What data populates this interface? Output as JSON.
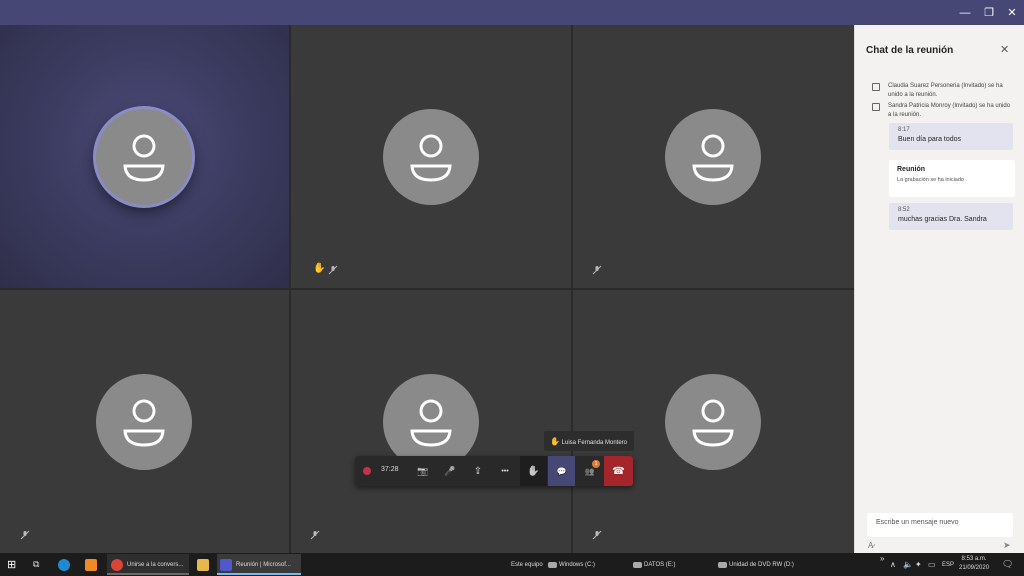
{
  "window": {
    "minimize_glyph": "—",
    "maximize_glyph": "❐",
    "close_glyph": "✕"
  },
  "participants": [
    {
      "id": "p1",
      "active": true,
      "muted": false,
      "hand_raised": false
    },
    {
      "id": "p2",
      "active": false,
      "muted": true,
      "hand_raised": true
    },
    {
      "id": "p3",
      "active": false,
      "muted": true,
      "hand_raised": false
    },
    {
      "id": "p4",
      "active": false,
      "muted": true,
      "hand_raised": false
    },
    {
      "id": "p5",
      "active": false,
      "muted": true,
      "hand_raised": false
    },
    {
      "id": "p6",
      "active": false,
      "muted": true,
      "hand_raised": false
    }
  ],
  "chat": {
    "title": "Chat de la reunión",
    "close_glyph": "✕",
    "messages": [
      {
        "type": "system",
        "text": "Claudia Suarez Personeria (Invitado) se ha unido a la reunión."
      },
      {
        "type": "system",
        "text": "Sandra Patricia Monroy (Invitado) se ha unido a la reunión."
      },
      {
        "type": "bubble",
        "time": "8:17",
        "text": "Buen día para todos"
      },
      {
        "type": "card",
        "title": "Reunión",
        "subtitle": "La grabación se ha iniciado"
      },
      {
        "type": "bubble",
        "time": "8:52",
        "text": "muchas gracias Dra. Sandra"
      }
    ],
    "compose_placeholder": "Escribe un mensaje nuevo",
    "format_glyph": "A̷",
    "send_glyph": "➤"
  },
  "raise_tooltip": {
    "hand_glyph": "✋",
    "name": "Luisa Fernanda Montero"
  },
  "controls": {
    "timer": "37:28",
    "camera_glyph": "📷",
    "mic_glyph": "🎤",
    "share_glyph": "⇪",
    "more_glyph": "•••",
    "hand_glyph": "✋",
    "chat_glyph": "💬",
    "participants_glyph": "👥",
    "participants_badge": "1",
    "hangup_glyph": "☎",
    "accent": "#464775",
    "hangup_color": "#a4262c"
  },
  "taskbar": {
    "start_glyph": "⊞",
    "task_view_glyph": "⧉",
    "apps": [
      {
        "label": "Unirse a la convers..."
      },
      {
        "label": "Reunión | Microsof..."
      }
    ],
    "este_equipo": "Este equipo",
    "drives": [
      {
        "label": "Windows (C:)"
      },
      {
        "label": "DATOS (E:)"
      },
      {
        "label": "Unidad de DVD RW (D:)"
      }
    ],
    "language": "ESP",
    "time": "8:53 a.m.",
    "date": "21/09/2020",
    "chevron_glyph": "»",
    "tray_up_glyph": "∧"
  }
}
